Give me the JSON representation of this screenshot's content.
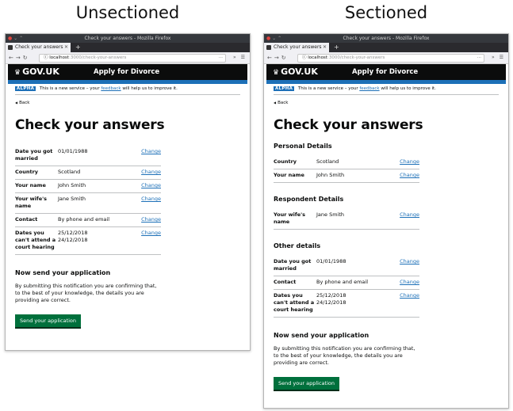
{
  "headings": {
    "left": "Unsectioned",
    "right": "Sectioned"
  },
  "browser": {
    "window_title": "Check your answers - Mozilla Firefox",
    "tab_title": "Check your answers",
    "url_host": "localhost",
    "url_path": ":3000/check-your-answers"
  },
  "gov": {
    "logo": "GOV.UK",
    "service": "Apply for Divorce",
    "phase_tag": "ALPHA",
    "phase_text": "This is a new service – your",
    "feedback_link": "feedback",
    "phase_text_end": "will help us to improve it.",
    "back": "Back",
    "title": "Check your answers",
    "change": "Change"
  },
  "left": {
    "rows": [
      {
        "key": "Date you got married",
        "value": "01/01/1988"
      },
      {
        "key": "Country",
        "value": "Scotland"
      },
      {
        "key": "Your name",
        "value": "John Smith"
      },
      {
        "key": "Your wife's name",
        "value": "Jane Smith"
      },
      {
        "key": "Contact",
        "value": "By phone and email"
      },
      {
        "key": "Dates you can't attend a court hearing",
        "value": "25/12/2018\n24/12/2018"
      }
    ]
  },
  "right": {
    "sections": [
      {
        "title": "Personal Details",
        "rows": [
          {
            "key": "Country",
            "value": "Scotland"
          },
          {
            "key": "Your name",
            "value": "John Smith"
          }
        ]
      },
      {
        "title": "Respondent Details",
        "rows": [
          {
            "key": "Your wife's name",
            "value": "Jane Smith"
          }
        ]
      },
      {
        "title": "Other details",
        "rows": [
          {
            "key": "Date you got married",
            "value": "01/01/1988"
          },
          {
            "key": "Contact",
            "value": "By phone and email"
          },
          {
            "key": "Dates you can't attend a court hearing",
            "value": "25/12/2018\n24/12/2018"
          }
        ]
      }
    ]
  },
  "send": {
    "heading": "Now send your application",
    "text": "By submitting this notification you are confirming that, to the best of your knowledge, the details you are providing are correct.",
    "button": "Send your application"
  }
}
